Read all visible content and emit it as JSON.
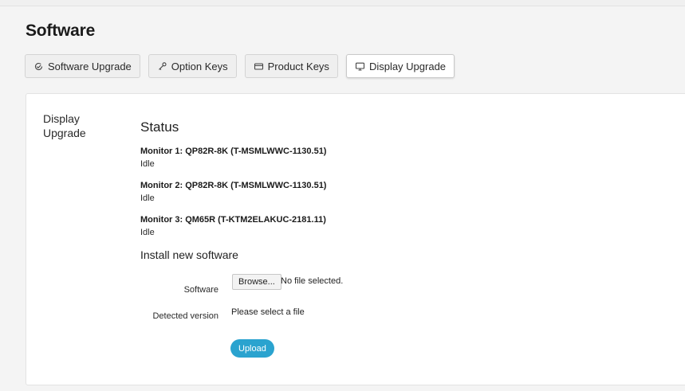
{
  "page": {
    "title": "Software"
  },
  "tabs": [
    {
      "label": "Software Upgrade",
      "icon": "software-upgrade-icon",
      "active": false
    },
    {
      "label": "Option Keys",
      "icon": "key-icon",
      "active": false
    },
    {
      "label": "Product Keys",
      "icon": "product-key-icon",
      "active": false
    },
    {
      "label": "Display Upgrade",
      "icon": "display-icon",
      "active": true
    }
  ],
  "panel": {
    "section_label": "Display Upgrade",
    "status_heading": "Status",
    "monitors": [
      {
        "name": "Monitor 1: QP82R-8K (T-MSMLWWC-1130.51)",
        "state": "Idle"
      },
      {
        "name": "Monitor 2: QP82R-8K (T-MSMLWWC-1130.51)",
        "state": "Idle"
      },
      {
        "name": "Monitor 3: QM65R (T-KTM2ELAKUC-2181.11)",
        "state": "Idle"
      }
    ],
    "install_heading": "Install new software",
    "software_label": "Software",
    "browse_label": "Browse...",
    "file_status": "No file selected.",
    "detected_version_label": "Detected version",
    "detected_version_value": "Please select a file",
    "upload_label": "Upload"
  },
  "colors": {
    "accent": "#2aa3cf",
    "background": "#f4f4f4",
    "panel": "#ffffff"
  }
}
